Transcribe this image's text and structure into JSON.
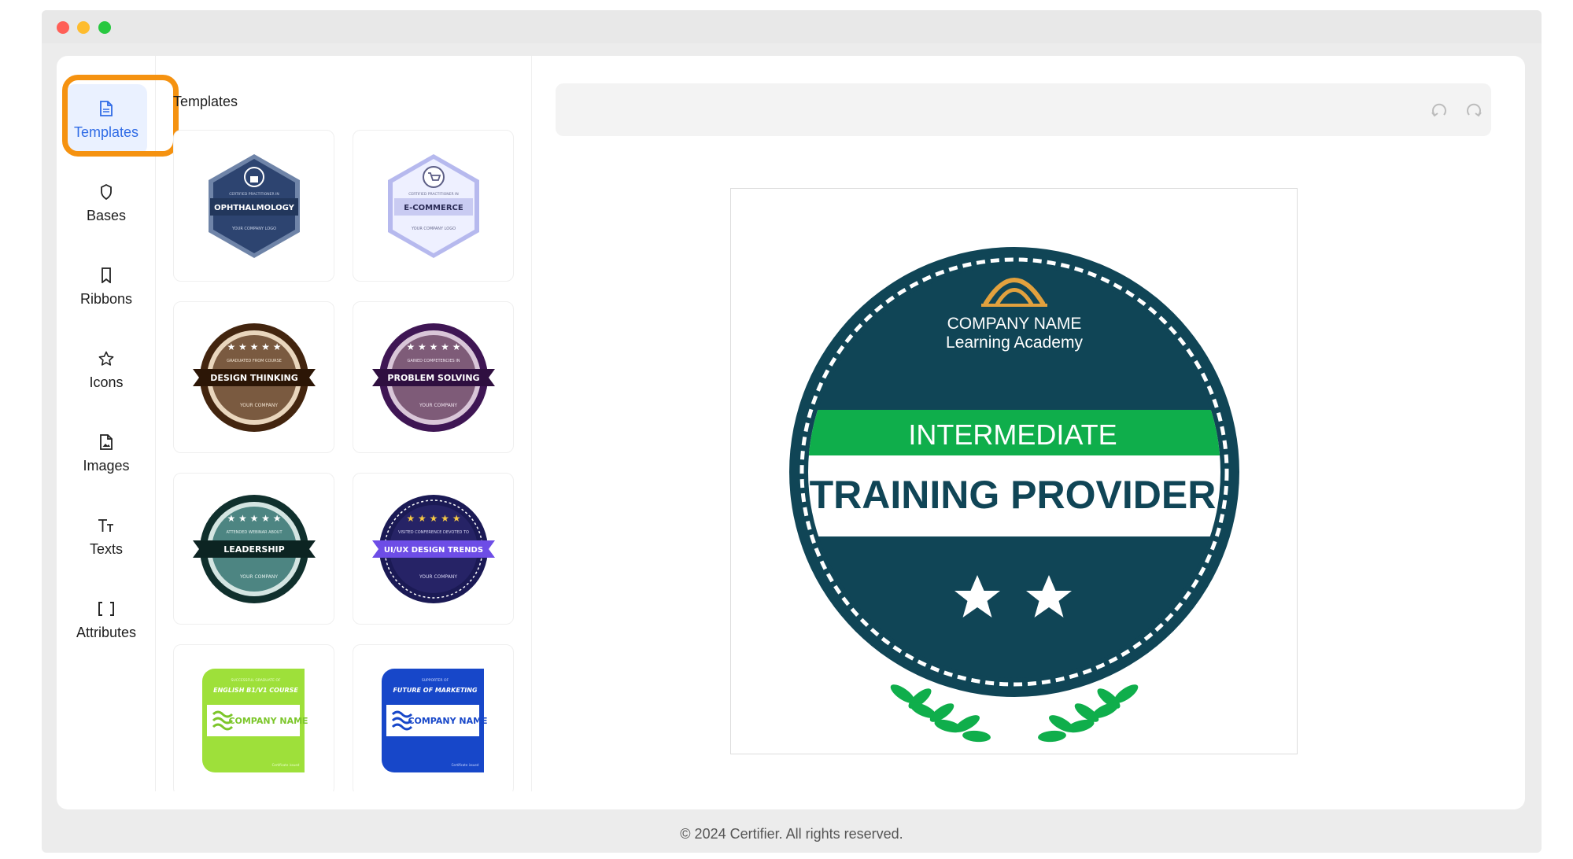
{
  "nav": {
    "items": [
      {
        "label": "Templates",
        "icon": "file-icon"
      },
      {
        "label": "Bases",
        "icon": "shield-icon"
      },
      {
        "label": "Ribbons",
        "icon": "bookmark-icon"
      },
      {
        "label": "Icons",
        "icon": "star-icon"
      },
      {
        "label": "Images",
        "icon": "image-file-icon"
      },
      {
        "label": "Texts",
        "icon": "text-icon"
      },
      {
        "label": "Attributes",
        "icon": "brackets-icon"
      }
    ],
    "active": "Templates"
  },
  "templates": {
    "title": "Templates",
    "cards": [
      {
        "top": "CERTIFIED PRACTITIONER IN",
        "title": "OPHTHALMOLOGY",
        "bottom": "YOUR COMPANY LOGO"
      },
      {
        "top": "CERTIFIED PRACTITIONER IN",
        "title": "E-COMMERCE",
        "bottom": "YOUR COMPANY LOGO"
      },
      {
        "top": "GRADUATED FROM COURSE",
        "title": "DESIGN THINKING",
        "bottom": "YOUR COMPANY"
      },
      {
        "top": "GAINED COMPETENCIES IN",
        "title": "PROBLEM SOLVING",
        "bottom": "YOUR COMPANY"
      },
      {
        "top": "ATTENDED WEBINAR ABOUT",
        "title": "LEADERSHIP",
        "bottom": "YOUR COMPANY"
      },
      {
        "top": "VISITED CONFERENCE DEVOTED TO",
        "title": "UI/UX DESIGN TRENDS",
        "bottom": "YOUR COMPANY"
      },
      {
        "top": "SUCCESSFUL GRADUATE OF",
        "title": "ENGLISH B1/V1 COURSE",
        "company": "COMPANY NAME",
        "bottom": "Certificate issued"
      },
      {
        "top": "SUPPORTER OF",
        "title": "FUTURE OF MARKETING",
        "company": "COMPANY NAME",
        "bottom": "Certificate issued"
      }
    ]
  },
  "toolbar": {
    "undo_icon": "undo-icon",
    "redo_icon": "redo-icon"
  },
  "badge": {
    "company": "COMPANY NAME",
    "academy": "Learning Academy",
    "level": "INTERMEDIATE",
    "title": "TRAINING PROVIDER",
    "colors": {
      "primary": "#104556",
      "accent": "#0fae4b",
      "gold": "#e2a13e"
    }
  },
  "footer": "© 2024 Certifier. All rights reserved."
}
